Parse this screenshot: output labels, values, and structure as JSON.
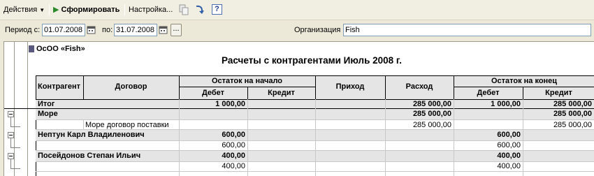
{
  "toolbar": {
    "actions_label": "Действия",
    "generate_label": "Сформировать",
    "settings_label": "Настройка...",
    "help_label": "?"
  },
  "filters": {
    "period_from_label": "Период с:",
    "period_from_value": "01.07.2008",
    "period_to_label": "по:",
    "period_to_value": "31.07.2008",
    "dots_label": "...",
    "org_label": "Организация",
    "org_value": "Fish"
  },
  "report": {
    "org_name": "ОсОО «Fish»",
    "title": "Расчеты с контрагентами Июль 2008 г.",
    "headers": {
      "counterparty": "Контрагент",
      "contract": "Договор",
      "opening_balance": "Остаток на начало",
      "income": "Приход",
      "expense": "Расход",
      "closing_balance": "Остаток на конец",
      "debit": "Дебет",
      "credit": "Кредит"
    },
    "rows": [
      {
        "name": "Итог",
        "open_debit": "1 000,00",
        "open_credit": "",
        "income": "",
        "expense": "285 000,00",
        "close_debit": "1 000,00",
        "close_credit": "285 000,00"
      },
      {
        "name": "Море",
        "open_debit": "",
        "open_credit": "",
        "income": "",
        "expense": "285 000,00",
        "close_debit": "",
        "close_credit": "285 000,00"
      },
      {
        "name": "Море договор поставки",
        "open_debit": "",
        "open_credit": "",
        "income": "",
        "expense": "285 000,00",
        "close_debit": "",
        "close_credit": "285 000,00"
      },
      {
        "name": "Нептун Карл Владиленович",
        "open_debit": "600,00",
        "open_credit": "",
        "income": "",
        "expense": "",
        "close_debit": "600,00",
        "close_credit": ""
      },
      {
        "name": "",
        "open_debit": "600,00",
        "open_credit": "",
        "income": "",
        "expense": "",
        "close_debit": "600,00",
        "close_credit": ""
      },
      {
        "name": "Посейдонов Степан Ильич",
        "open_debit": "400,00",
        "open_credit": "",
        "income": "",
        "expense": "",
        "close_debit": "400,00",
        "close_credit": ""
      },
      {
        "name": "",
        "open_debit": "400,00",
        "open_credit": "",
        "income": "",
        "expense": "",
        "close_debit": "400,00",
        "close_credit": ""
      }
    ]
  }
}
